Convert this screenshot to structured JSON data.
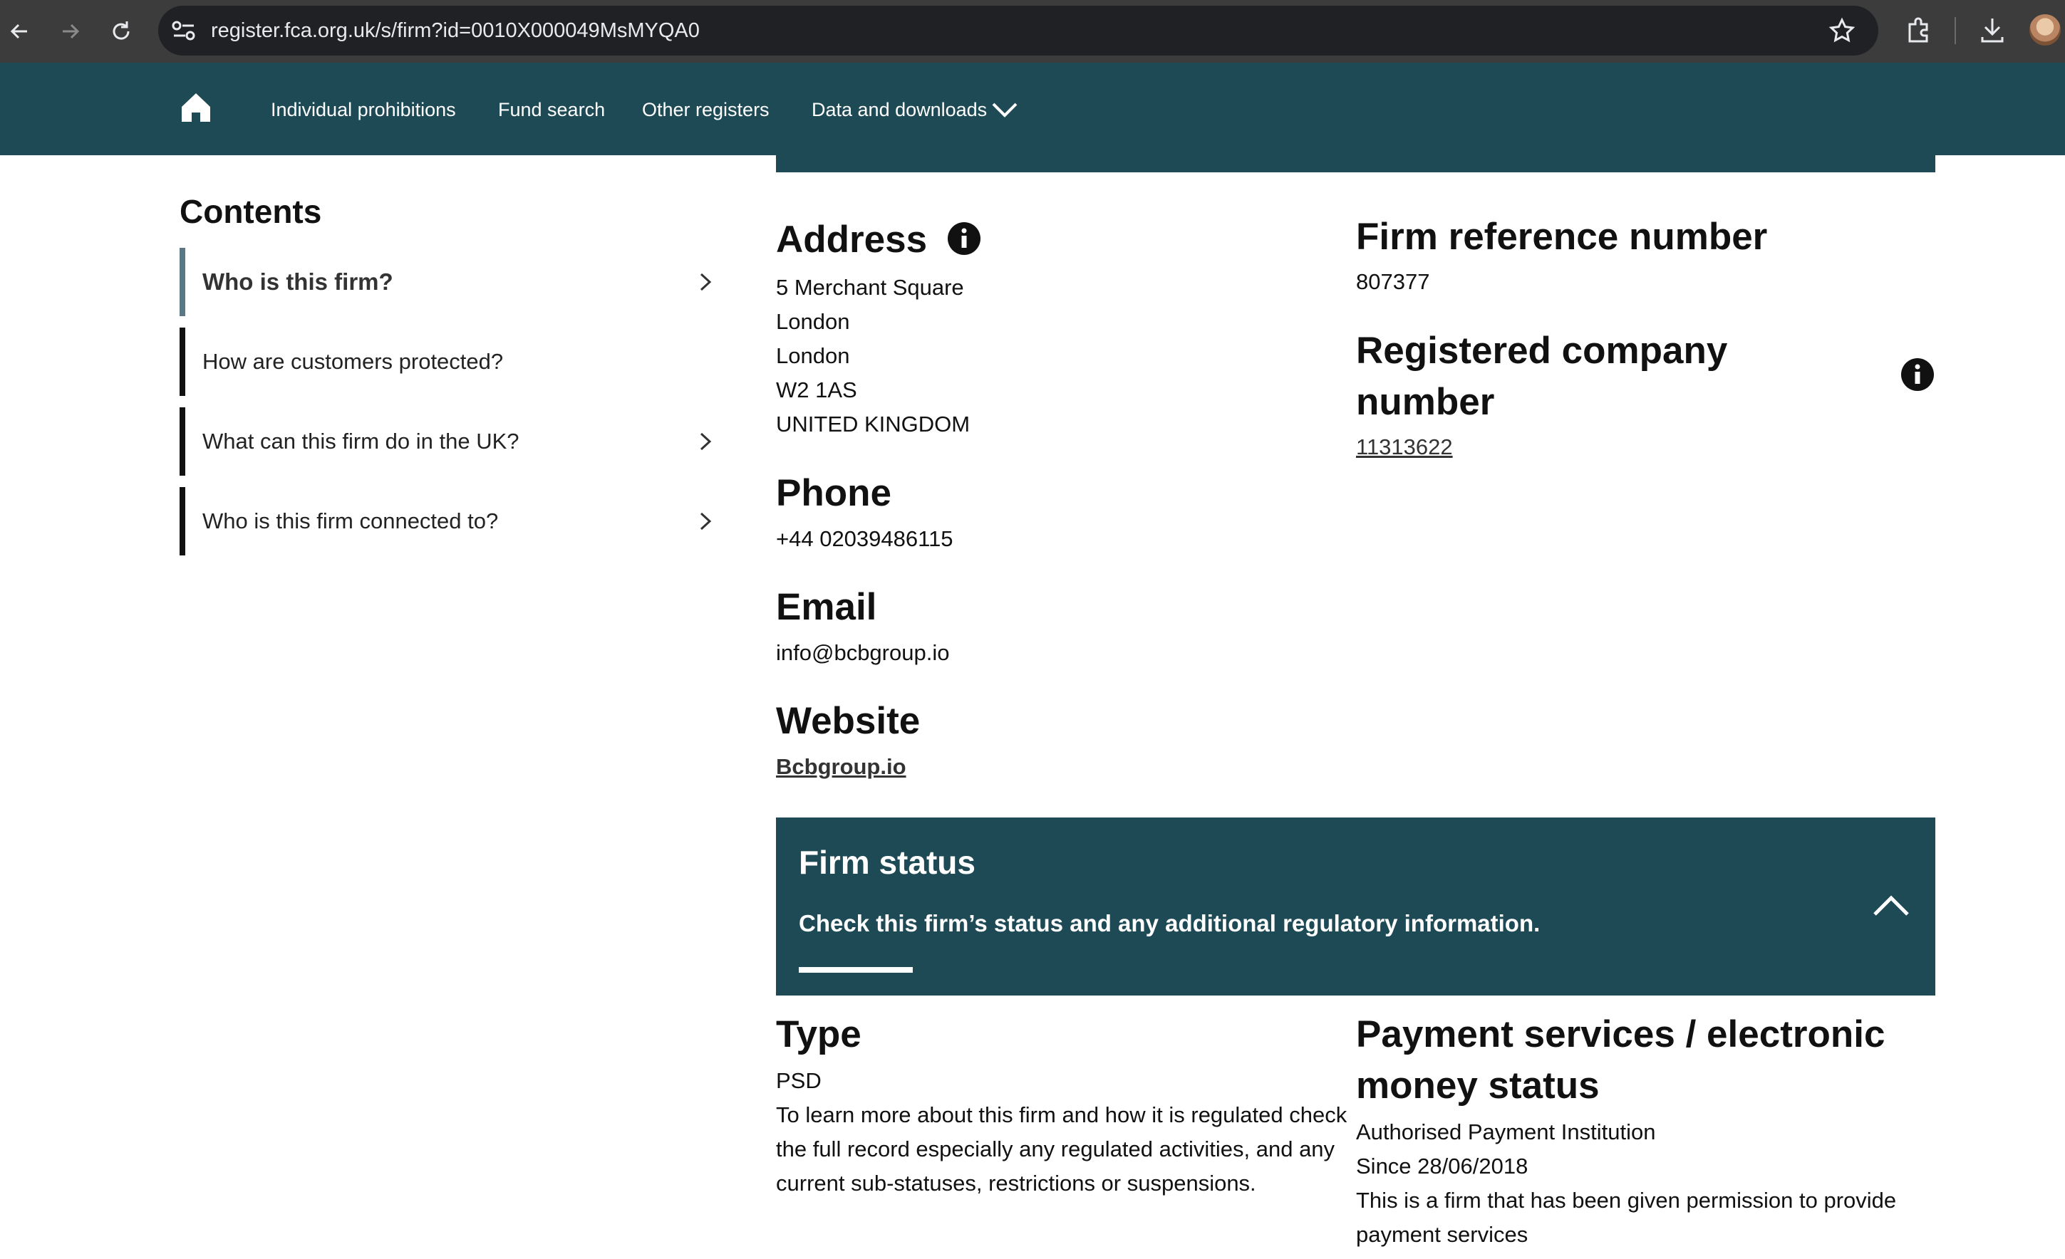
{
  "browser": {
    "url": "register.fca.org.uk/s/firm?id=0010X000049MsMYQA0"
  },
  "site_nav": {
    "items": [
      {
        "label": "Individual prohibitions"
      },
      {
        "label": "Fund search"
      },
      {
        "label": "Other registers"
      },
      {
        "label": "Data and downloads"
      }
    ]
  },
  "contents": {
    "title": "Contents",
    "items": [
      {
        "label": "Who is this firm?",
        "active": true
      },
      {
        "label": "How are customers protected?"
      },
      {
        "label": "What can this firm do in the UK?"
      },
      {
        "label": "Who is this firm connected to?"
      }
    ]
  },
  "firm": {
    "address_heading": "Address",
    "address_lines": [
      "5 Merchant Square",
      "London",
      "London",
      "W2 1AS",
      "UNITED KINGDOM"
    ],
    "phone_heading": "Phone",
    "phone": "+44 02039486115",
    "email_heading": "Email",
    "email": "info@bcbgroup.io",
    "website_heading": "Website",
    "website": "Bcbgroup.io",
    "frn_heading": "Firm reference number",
    "frn": "807377",
    "company_heading_line1": "Registered company",
    "company_heading_line2": "number",
    "company_number": "11313622"
  },
  "firm_status": {
    "title": "Firm status",
    "subtitle": "Check this firm’s status and any additional regulatory information.",
    "type_heading": "Type",
    "type_value": "PSD",
    "type_desc_lines": [
      "To learn more about this firm and how it is regulated check",
      "the full record especially any regulated activities, and any",
      "current sub-statuses, restrictions or suspensions."
    ],
    "ps_heading_line1": "Payment services / electronic",
    "ps_heading_line2": "money status",
    "ps_value": "Authorised Payment Institution",
    "ps_since": "Since 28/06/2018",
    "ps_desc_lines": [
      "This is a firm that has been given permission to provide",
      "payment services"
    ]
  },
  "colors": {
    "brand_teal": "#1e4a55",
    "active_bar": "#5a7784"
  }
}
